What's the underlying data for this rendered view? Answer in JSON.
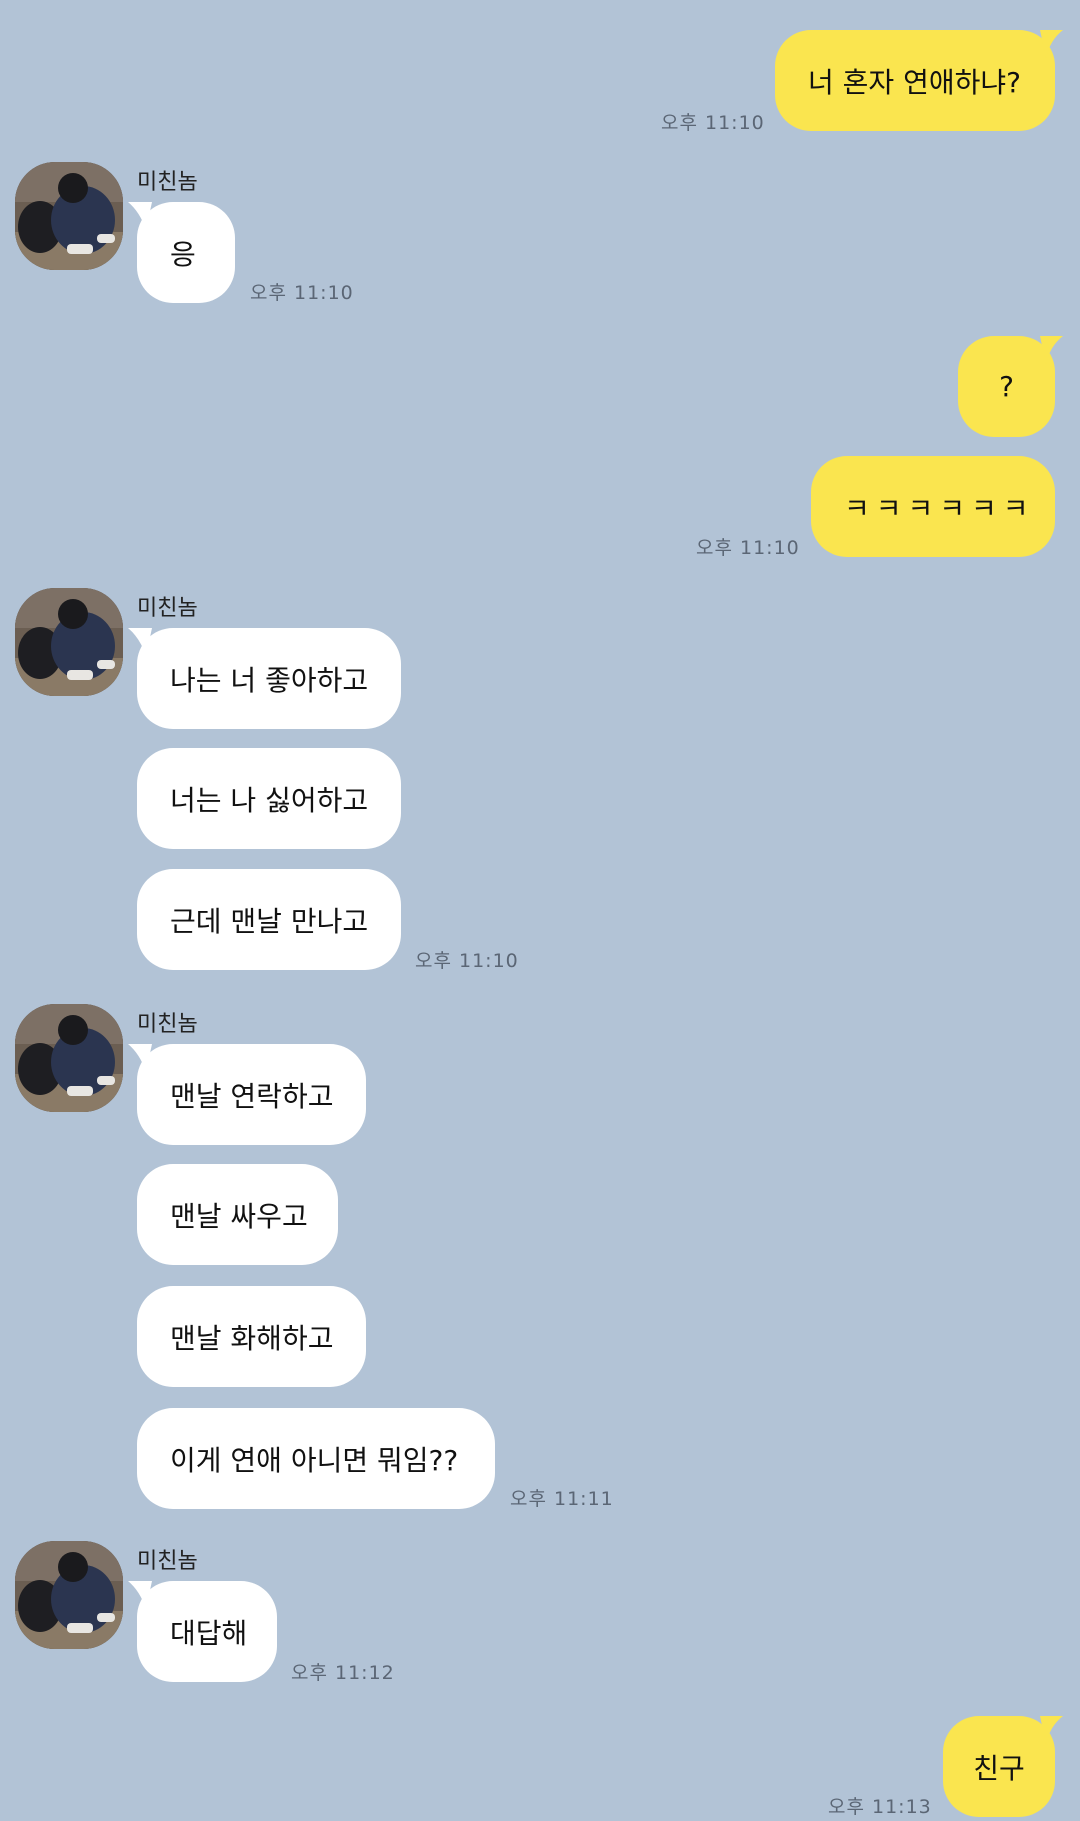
{
  "sender_name": "미친놈",
  "messages": {
    "m1": {
      "text": "너 혼자 연애하냐?",
      "time": "오후 11:10"
    },
    "m2": {
      "text": "응",
      "time": "오후 11:10"
    },
    "m3": {
      "text": "?"
    },
    "m4": {
      "text": "ㅋㅋㅋㅋㅋㅋ",
      "time": "오후 11:10"
    },
    "m5": {
      "text": "나는 너 좋아하고"
    },
    "m6": {
      "text": "너는 나 싫어하고"
    },
    "m7": {
      "text": "근데 맨날 만나고",
      "time": "오후 11:10"
    },
    "m8": {
      "text": "맨날 연락하고"
    },
    "m9": {
      "text": "맨날 싸우고"
    },
    "m10": {
      "text": "맨날 화해하고"
    },
    "m11": {
      "text": "이게 연애 아니면 뭐임??",
      "time": "오후 11:11"
    },
    "m12": {
      "text": "대답해",
      "time": "오후 11:12"
    },
    "m13": {
      "text": "친구",
      "time": "오후 11:13"
    }
  },
  "colors": {
    "background": "#b2c3d6",
    "my_bubble": "#fae54f",
    "their_bubble": "#ffffff",
    "timestamp": "#5b6675"
  },
  "icons": {
    "avatar": "profile-photo"
  }
}
